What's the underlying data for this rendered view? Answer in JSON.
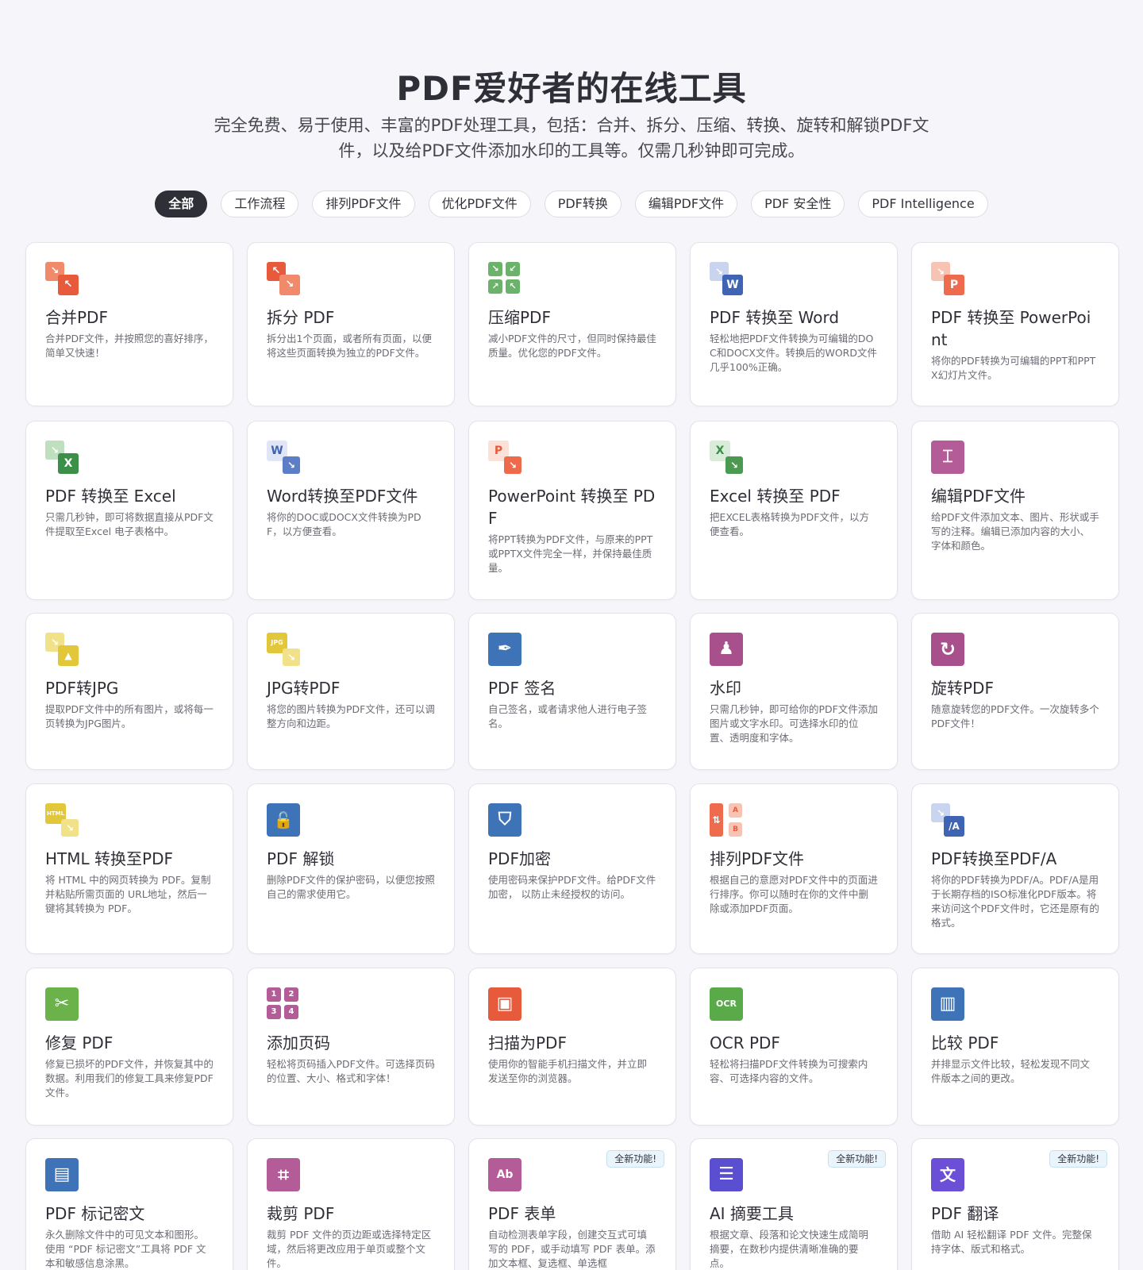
{
  "hero": {
    "title": "PDF爱好者的在线工具",
    "subtitle_line1": "完全免费、易于使用、丰富的PDF处理工具，包括：合并、拆分、压缩、转换、旋转和解锁PDF文",
    "subtitle_line2": "件，以及给PDF文件添加水印的工具等。仅需几秒钟即可完成。"
  },
  "tabs": [
    "全部",
    "工作流程",
    "排列PDF文件",
    "优化PDF文件",
    "PDF转换",
    "编辑PDF文件",
    "PDF 安全性",
    "PDF Intelligence"
  ],
  "badge_label": "全新功能!",
  "tools": [
    {
      "title": "合并PDF",
      "desc": "合并PDF文件，并按照您的喜好排序，简单又快速！",
      "icon": "merge-icon"
    },
    {
      "title": "拆分 PDF",
      "desc": "拆分出1个页面，或者所有页面，以便将这些页面转换为独立的PDF文件。",
      "icon": "split-icon"
    },
    {
      "title": "压缩PDF",
      "desc": "减小PDF文件的尺寸，但同时保持最佳质量。优化您的PDF文件。",
      "icon": "compress-icon"
    },
    {
      "title": "PDF 转换至 Word",
      "desc": "轻松地把PDF文件转换为可编辑的DOC和DOCX文件。转换后的WORD文件几乎100%正确。",
      "icon": "pdf-to-word-icon"
    },
    {
      "title": "PDF 转换至 PowerPoint",
      "desc": "将你的PDF转换为可编辑的PPT和PPTX幻灯片文件。",
      "icon": "pdf-to-powerpoint-icon"
    },
    {
      "title": "PDF 转换至 Excel",
      "desc": "只需几秒钟，即可将数据直接从PDF文件提取至Excel 电子表格中。",
      "icon": "pdf-to-excel-icon"
    },
    {
      "title": "Word转换至PDF文件",
      "desc": "将你的DOC或DOCX文件转换为PDF，以方便查看。",
      "icon": "word-to-pdf-icon"
    },
    {
      "title": "PowerPoint 转换至 PDF",
      "desc": "将PPT转换为PDF文件，与原来的PPT或PPTX文件完全一样，并保持最佳质量。",
      "icon": "powerpoint-to-pdf-icon"
    },
    {
      "title": "Excel 转换至 PDF",
      "desc": "把EXCEL表格转换为PDF文件，以方便查看。",
      "icon": "excel-to-pdf-icon"
    },
    {
      "title": "编辑PDF文件",
      "desc": "给PDF文件添加文本、图片、形状或手写的注释。编辑已添加内容的大小、字体和颜色。",
      "icon": "edit-pdf-icon"
    },
    {
      "title": "PDF转JPG",
      "desc": "提取PDF文件中的所有图片，或将每一页转换为JPG图片。",
      "icon": "pdf-to-jpg-icon"
    },
    {
      "title": "JPG转PDF",
      "desc": "将您的图片转换为PDF文件，还可以调整方向和边距。",
      "icon": "jpg-to-pdf-icon"
    },
    {
      "title": "PDF 签名",
      "desc": "自己签名，或者请求他人进行电子签名。",
      "icon": "sign-icon"
    },
    {
      "title": "水印",
      "desc": "只需几秒钟，即可给你的PDF文件添加图片或文字水印。可选择水印的位置、透明度和字体。",
      "icon": "watermark-icon"
    },
    {
      "title": "旋转PDF",
      "desc": "随意旋转您的PDF文件。一次旋转多个PDF文件！",
      "icon": "rotate-icon"
    },
    {
      "title": "HTML 转换至PDF",
      "desc": "将 HTML 中的网页转换为 PDF。复制并粘贴所需页面的 URL地址，然后一键将其转换为 PDF。",
      "icon": "html-to-pdf-icon"
    },
    {
      "title": "PDF 解锁",
      "desc": "删除PDF文件的保护密码，以便您按照自己的需求使用它。",
      "icon": "unlock-icon"
    },
    {
      "title": "PDF加密",
      "desc": "使用密码来保护PDF文件。给PDF文件加密， 以防止未经授权的访问。",
      "icon": "protect-icon"
    },
    {
      "title": "排列PDF文件",
      "desc": "根据自己的意愿对PDF文件中的页面进行排序。你可以随时在你的文件中删除或添加PDF页面。",
      "icon": "organize-icon"
    },
    {
      "title": "PDF转换至PDF/A",
      "desc": "将你的PDF转换为PDF/A。PDF/A是用于长期存档的ISO标准化PDF版本。将来访问这个PDF文件时，它还是原有的格式。",
      "icon": "pdf-to-pdfa-icon"
    },
    {
      "title": "修复 PDF",
      "desc": "修复已损坏的PDF文件，并恢复其中的数据。利用我们的修复工具来修复PDF文件。",
      "icon": "repair-icon"
    },
    {
      "title": "添加页码",
      "desc": "轻松将页码插入PDF文件。可选择页码的位置、大小、格式和字体！",
      "icon": "page-numbers-icon"
    },
    {
      "title": "扫描为PDF",
      "desc": "使用你的智能手机扫描文件，并立即发送至你的浏览器。",
      "icon": "scan-icon"
    },
    {
      "title": "OCR PDF",
      "desc": "轻松将扫描PDF文件转换为可搜索内容、可选择内容的文件。",
      "icon": "ocr-icon"
    },
    {
      "title": "比较 PDF",
      "desc": "并排显示文件比较，轻松发现不同文件版本之间的更改。",
      "icon": "compare-icon"
    },
    {
      "title": "PDF 标记密文",
      "desc": "永久删除文件中的可见文本和图形。使用 “PDF 标记密文”工具将 PDF 文本和敏感信息涂黑。",
      "icon": "redact-icon"
    },
    {
      "title": "裁剪 PDF",
      "desc": "裁剪 PDF 文件的页边距或选择特定区域，然后将更改应用于单页或整个文件。",
      "icon": "crop-icon"
    },
    {
      "title": "PDF 表单",
      "desc": "自动检测表单字段，创建交互式可填写的 PDF，或手动填写 PDF 表单。添加文本框、复选框、单选框",
      "icon": "forms-icon",
      "badge": true
    },
    {
      "title": "AI 摘要工具",
      "desc": "根据文章、段落和论文快速生成简明摘要，在数秒内提供清晰准确的要点。",
      "icon": "ai-summary-icon",
      "badge": true
    },
    {
      "title": "PDF 翻译",
      "desc": "借助 AI 轻松翻译 PDF 文件。完整保持字体、版式和格式。",
      "icon": "translate-icon",
      "badge": true
    }
  ]
}
